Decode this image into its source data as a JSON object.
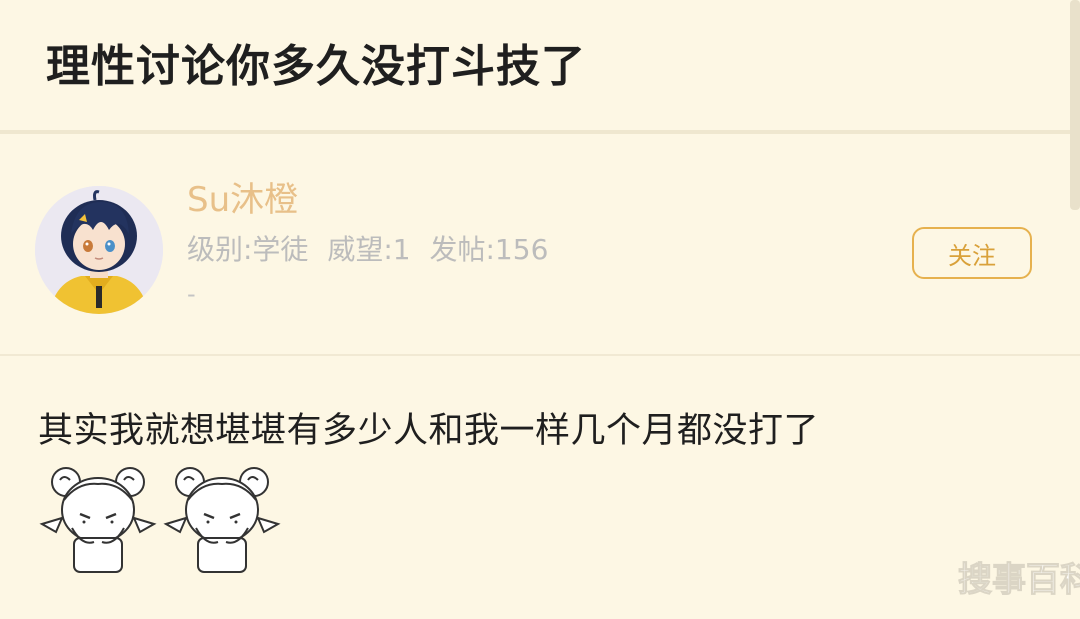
{
  "post": {
    "title": "理性讨论你多久没打斗技了",
    "content": "其实我就想堪堪有多少人和我一样几个月都没打了"
  },
  "author": {
    "username": "Su沐橙",
    "level": "级别:学徒",
    "prestige": "威望:1",
    "posts": "发帖:156",
    "signature": "-",
    "follow_label": "关注"
  },
  "watermark": "搜事百科",
  "colors": {
    "background": "#fdf7e4",
    "username": "#e8c089",
    "accent": "#e6b14e"
  }
}
